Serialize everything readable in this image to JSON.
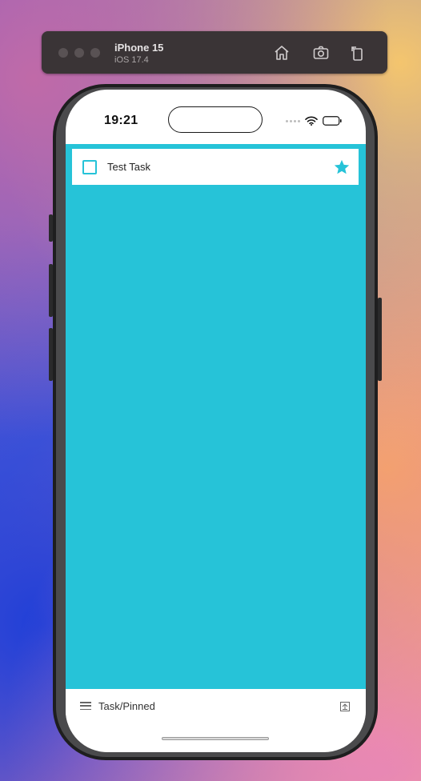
{
  "simulator": {
    "device_name": "iPhone 15",
    "os_version": "iOS 17.4",
    "toolbar_icons": [
      "home-icon",
      "screenshot-icon",
      "rotate-icon"
    ]
  },
  "status_bar": {
    "time": "19:21",
    "icons": [
      "cellular-dots-icon",
      "wifi-icon",
      "battery-icon"
    ]
  },
  "app": {
    "background_color": "#26c3d8",
    "task": {
      "title": "Test Task",
      "checked": false,
      "pinned": true,
      "accent_color": "#26c3d8"
    }
  },
  "storybook_bar": {
    "story_name": "Task/Pinned",
    "icons": [
      "menu-icon",
      "addons-icon"
    ]
  }
}
